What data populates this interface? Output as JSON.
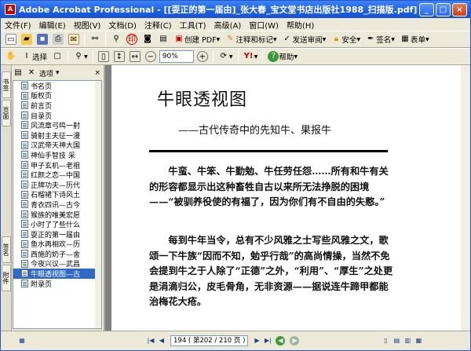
{
  "window": {
    "title": "Adobe Acrobat Professional - [[耍正的第一届由]_张大春_宝文堂书店出版社1988_扫描版.pdf]",
    "icon": "acrobat-icon"
  },
  "menu": [
    "文件(F)",
    "编辑(E)",
    "视图(V)",
    "文档(D)",
    "注释(C)",
    "工具(T)",
    "高级(A)",
    "窗口(W)",
    "帮助(H)"
  ],
  "toolbar1": {
    "create_pdf": "创建 PDF",
    "comment_markup": "注释和标记",
    "send_review": "发送审阅",
    "security": "安全",
    "sign": "签名",
    "forms": "表单"
  },
  "toolbar2": {
    "select": "选择",
    "zoom_value": "90%",
    "help": "帮助"
  },
  "sidebar": {
    "tabs": [
      "书签",
      "页面",
      "签名",
      "附件"
    ],
    "options_label": "选项",
    "bookmarks": [
      "书名页",
      "版权页",
      "前言页",
      "目录页",
      "风流章弓鸣一射",
      "骑射主夫征一漫",
      "汉武帝天神大国",
      "神仙手智技 采",
      "甲子玄机—老祖",
      "红颜之恋—中国",
      "正牌功夫—历代",
      "石榴裙下诗风土",
      "青衣四讯—古今",
      "猴族的唯美宏愿",
      "小时了了些什么",
      "耍正的第一届由",
      "鱼水再相欢—历",
      "西施的奶子—舍",
      "今夜兴议—武昌",
      "牛眼透视图—古",
      "附录页"
    ],
    "selected_index": 19
  },
  "document": {
    "title": "牛眼透视图",
    "subtitle": "——古代传奇中的先知牛、果报牛",
    "paragraph1": "牛蛮、牛笨、牛勤勉、牛任劳任怨……所有和牛有关的形容都显示出这种畜牲自古以来所无法挣脱的困境——“被驯养役使的有福了，因为你们有不自由的失憨。”",
    "paragraph2": "每到牛年当令，总有不少风雅之士写些风雅之文，歌颂一下牛族“因而不知，勉乎行哉”的高尚情操，当然不免会提到牛之于人除了“正德”之外，“利用”、“厚生”之处更是涓滴归公，皮毛骨角，无非资源——据说连牛蹄甲都能治梅花大疮。"
  },
  "status": {
    "page_display": "194 ( 第202 / 210 页 )"
  },
  "colors": {
    "title_bar": "#1f5fe0",
    "selection": "#316ac5"
  }
}
